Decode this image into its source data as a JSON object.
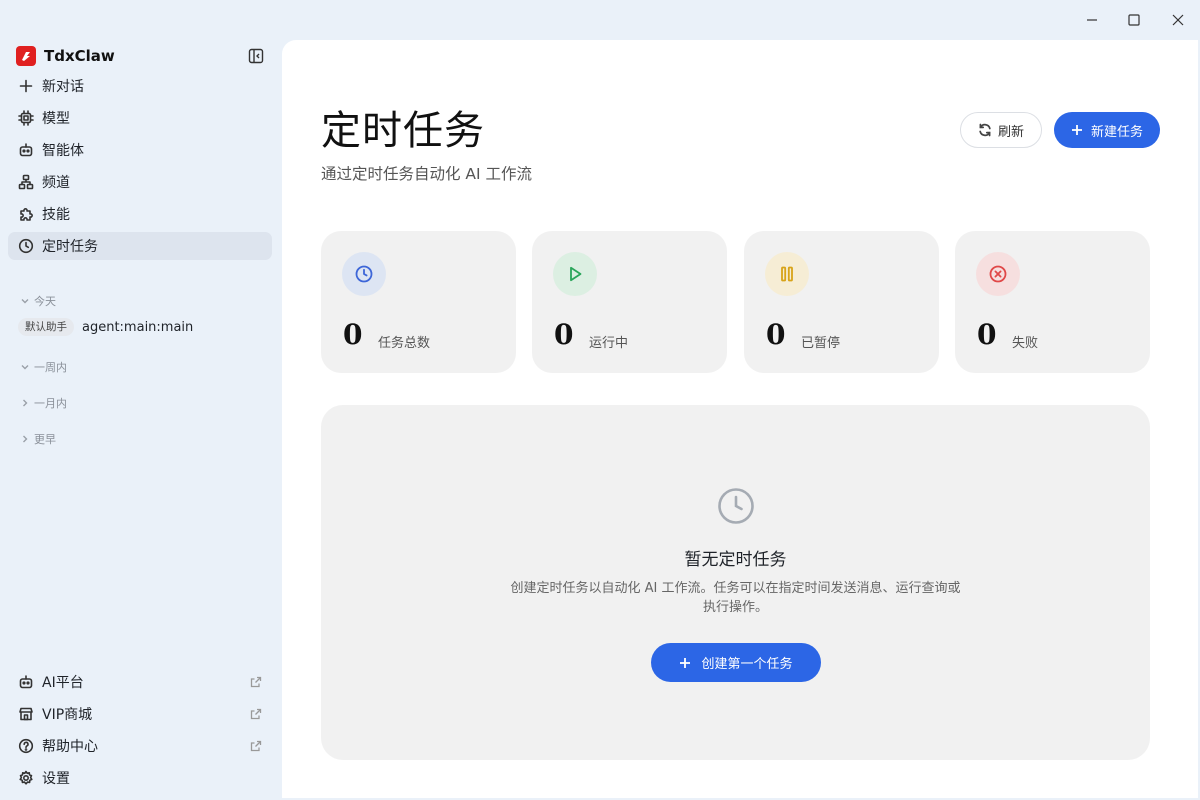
{
  "app": {
    "name": "TdxClaw"
  },
  "sidebar": {
    "items": [
      {
        "label": "新对话",
        "icon": "plus-icon"
      },
      {
        "label": "模型",
        "icon": "chip-icon"
      },
      {
        "label": "智能体",
        "icon": "robot-icon"
      },
      {
        "label": "频道",
        "icon": "network-icon"
      },
      {
        "label": "技能",
        "icon": "puzzle-icon"
      },
      {
        "label": "定时任务",
        "icon": "clock-icon",
        "active": true
      }
    ],
    "groups": {
      "today": "今天",
      "week": "一周内",
      "month": "一月内",
      "earlier": "更早"
    },
    "session": {
      "tag": "默认助手",
      "name": "agent:main:main"
    },
    "bottom": [
      {
        "label": "AI平台",
        "icon": "robot-icon",
        "external": true
      },
      {
        "label": "VIP商城",
        "icon": "store-icon",
        "external": true
      },
      {
        "label": "帮助中心",
        "icon": "help-icon",
        "external": true
      },
      {
        "label": "设置",
        "icon": "gear-icon",
        "external": false
      }
    ]
  },
  "header": {
    "title": "定时任务",
    "subtitle": "通过定时任务自动化 AI 工作流",
    "refresh_label": "刷新",
    "new_label": "新建任务"
  },
  "stats": [
    {
      "value": "0",
      "label": "任务总数",
      "icon": "clock-icon",
      "color": "#3d66d8",
      "bg": "#dde5f3"
    },
    {
      "value": "0",
      "label": "运行中",
      "icon": "play-icon",
      "color": "#2aa55a",
      "bg": "#dcefe2"
    },
    {
      "value": "0",
      "label": "已暂停",
      "icon": "pause-icon",
      "color": "#d8a318",
      "bg": "#f6edd5"
    },
    {
      "value": "0",
      "label": "失败",
      "icon": "error-icon",
      "color": "#e04848",
      "bg": "#f6dfdf"
    }
  ],
  "empty": {
    "title": "暂无定时任务",
    "description": "创建定时任务以自动化 AI 工作流。任务可以在指定时间发送消息、运行查询或执行操作。",
    "button_label": "创建第一个任务"
  },
  "colors": {
    "accent": "#2c66e6",
    "sidebar_bg": "#eaf1f9",
    "card_bg": "#f1f1f1"
  }
}
